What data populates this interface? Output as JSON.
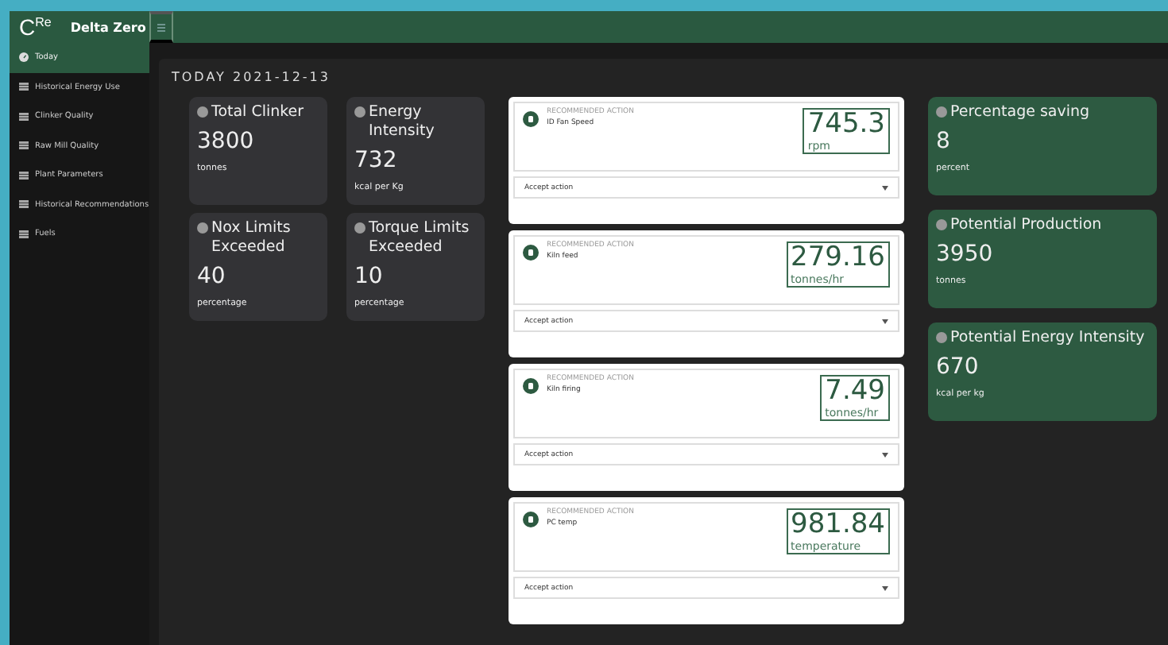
{
  "header": {
    "logo": "C$^{Re}$",
    "title": "Delta Zero"
  },
  "sidebar": {
    "items": [
      {
        "label": "Today",
        "selected": true,
        "kind": "gauge"
      },
      {
        "label": "Historical Energy Use",
        "selected": false,
        "kind": "page"
      },
      {
        "label": "Clinker Quality",
        "selected": false,
        "kind": "page"
      },
      {
        "label": "Raw Mill Quality",
        "selected": false,
        "kind": "page"
      },
      {
        "label": "Plant Parameters",
        "selected": false,
        "kind": "page"
      },
      {
        "label": "Historical Recommendations",
        "selected": false,
        "kind": "page"
      },
      {
        "label": "Fuels",
        "selected": false,
        "kind": "page"
      }
    ]
  },
  "heading": "TODAY 2021-12-13",
  "metrics": [
    {
      "title": "Total Clinker",
      "value": "3800",
      "unit": "tonnes"
    },
    {
      "title": "Energy Intensity",
      "value": "732",
      "unit": "kcal per Kg"
    },
    {
      "title": "Nox Limits Exceeded",
      "value": "40",
      "unit": "percentage"
    },
    {
      "title": "Torque Limits Exceeded",
      "value": "10",
      "unit": "percentage"
    }
  ],
  "actions": [
    {
      "label": "RECOMMENDED ACTION",
      "name": "ID Fan Speed",
      "value": "745.3",
      "unit": "rpm",
      "select": "Accept action"
    },
    {
      "label": "RECOMMENDED ACTION",
      "name": "Kiln feed",
      "value": "279.16",
      "unit": "tonnes/hr",
      "select": "Accept action"
    },
    {
      "label": "RECOMMENDED ACTION",
      "name": "Kiln firing",
      "value": "7.49",
      "unit": "tonnes/hr",
      "select": "Accept action"
    },
    {
      "label": "RECOMMENDED ACTION",
      "name": "PC temp",
      "value": "981.84",
      "unit": "temperature",
      "select": "Accept action"
    }
  ],
  "outcomes": [
    {
      "title": "Percentage saving",
      "value": "8",
      "unit": "percent"
    },
    {
      "title": "Potential Production",
      "value": "3950",
      "unit": "tonnes"
    },
    {
      "title": "Potential Energy Intensity",
      "value": "670",
      "unit": "kcal per kg"
    }
  ]
}
